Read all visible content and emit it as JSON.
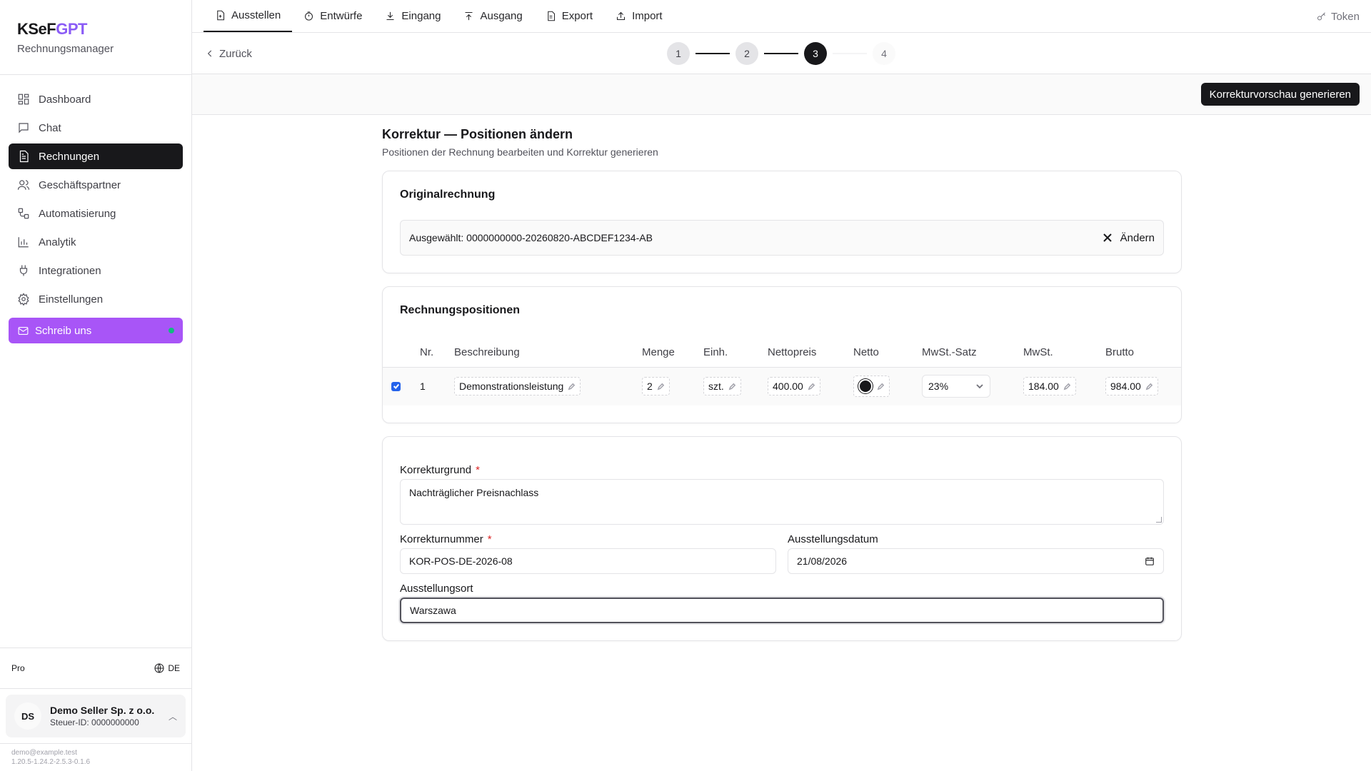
{
  "brand": {
    "name_a": "KSeF",
    "name_b": "GPT",
    "subtitle": "Rechnungsmanager"
  },
  "sidebar": {
    "items": [
      {
        "label": "Dashboard",
        "icon": "dashboard-icon"
      },
      {
        "label": "Chat",
        "icon": "chat-icon"
      },
      {
        "label": "Rechnungen",
        "icon": "invoice-icon",
        "active": true
      },
      {
        "label": "Geschäftspartner",
        "icon": "users-icon"
      },
      {
        "label": "Automatisierung",
        "icon": "workflow-icon"
      },
      {
        "label": "Analytik",
        "icon": "chart-icon"
      },
      {
        "label": "Integrationen",
        "icon": "plug-icon"
      },
      {
        "label": "Einstellungen",
        "icon": "gear-icon"
      }
    ],
    "cta": "Schreib uns",
    "plan": "Pro",
    "language": "DE",
    "account": {
      "initials": "DS",
      "name": "Demo Seller Sp. z o.o.",
      "tax_id": "Steuer-ID: 0000000000"
    },
    "email": "demo@example.test",
    "version": "1.20.5-1.24.2-2.5.3-0.1.6"
  },
  "tabs": [
    "Ausstellen",
    "Entwürfe",
    "Eingang",
    "Ausgang",
    "Export",
    "Import"
  ],
  "token_label": "Token",
  "subbar": {
    "back": "Zurück",
    "steps": [
      "1",
      "2",
      "3",
      "4"
    ],
    "current_step": 3
  },
  "action": {
    "generate": "Korrekturvorschau generieren"
  },
  "page": {
    "title": "Korrektur — Positionen ändern",
    "subtitle": "Positionen der Rechnung bearbeiten und Korrektur generieren"
  },
  "original": {
    "title": "Originalrechnung",
    "selected": "Ausgewählt: 0000000000-20260820-ABCDEF1234-AB",
    "change": "Ändern"
  },
  "positions": {
    "title": "Rechnungspositionen",
    "columns": [
      "Nr.",
      "Beschreibung",
      "Menge",
      "Einh.",
      "Nettopreis",
      "Netto",
      "MwSt.-Satz",
      "MwSt.",
      "Brutto"
    ],
    "rows": [
      {
        "nr": "1",
        "description": "Demonstrationsleistung",
        "qty": "2",
        "unit": "szt.",
        "unit_price": "400.00",
        "vat_rate": "23%",
        "vat": "184.00",
        "gross": "984.00",
        "checked": true
      }
    ]
  },
  "form": {
    "reason_label": "Korrekturgrund",
    "reason_value": "Nachträglicher Preisnachlass",
    "number_label": "Korrekturnummer",
    "number_value": "KOR-POS-DE-2026-08",
    "date_label": "Ausstellungsdatum",
    "date_value": "21/08/2026",
    "place_label": "Ausstellungsort",
    "place_value": "Warszawa",
    "required_mark": "*"
  }
}
